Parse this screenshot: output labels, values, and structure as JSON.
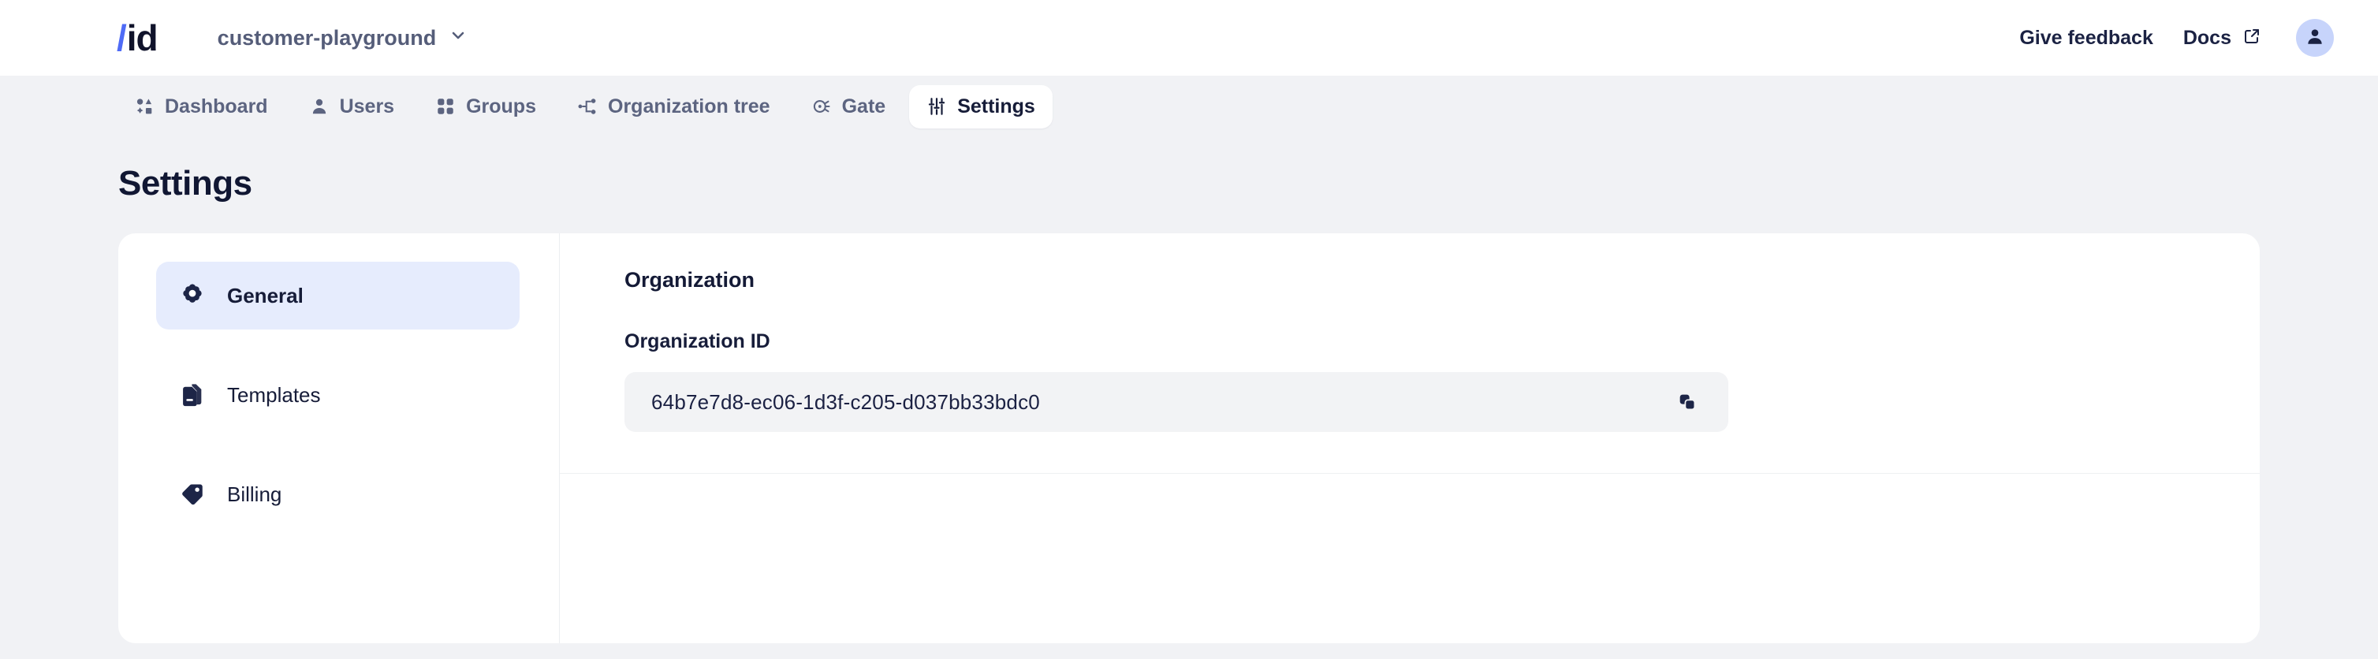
{
  "header": {
    "logo": {
      "slash": "/",
      "name": "id"
    },
    "org_switcher": {
      "label": "customer-playground",
      "icon": "chevron-down-icon"
    },
    "feedback_label": "Give feedback",
    "docs_label": "Docs",
    "docs_icon": "external-link-icon",
    "avatar_icon": "user-avatar-icon"
  },
  "tabs": [
    {
      "label": "Dashboard",
      "icon": "dashboard-shapes-icon",
      "active": false
    },
    {
      "label": "Users",
      "icon": "user-icon",
      "active": false
    },
    {
      "label": "Groups",
      "icon": "grid-dots-icon",
      "active": false
    },
    {
      "label": "Organization tree",
      "icon": "node-tree-icon",
      "active": false
    },
    {
      "label": "Gate",
      "icon": "gate-target-icon",
      "active": false
    },
    {
      "label": "Settings",
      "icon": "sliders-icon",
      "active": true
    }
  ],
  "page": {
    "title": "Settings"
  },
  "side_nav": [
    {
      "label": "General",
      "icon": "gear-icon",
      "active": true
    },
    {
      "label": "Templates",
      "icon": "document-icon",
      "active": false
    },
    {
      "label": "Billing",
      "icon": "tag-icon",
      "active": false
    }
  ],
  "organization": {
    "section_title": "Organization",
    "org_id_label": "Organization ID",
    "org_id_value": "64b7e7d8-ec06-1d3f-c205-d037bb33bdc0",
    "copy_icon": "copy-icon"
  },
  "colors": {
    "accent_blue": "#4f6bf6",
    "active_nav_bg": "#e6ecfd",
    "page_bg": "#f1f2f5",
    "card_bg": "#ffffff",
    "text_dark": "#161c38",
    "text_muted": "#5c6480",
    "field_bg": "#f2f3f5",
    "avatar_bg": "#c7d4fb"
  }
}
